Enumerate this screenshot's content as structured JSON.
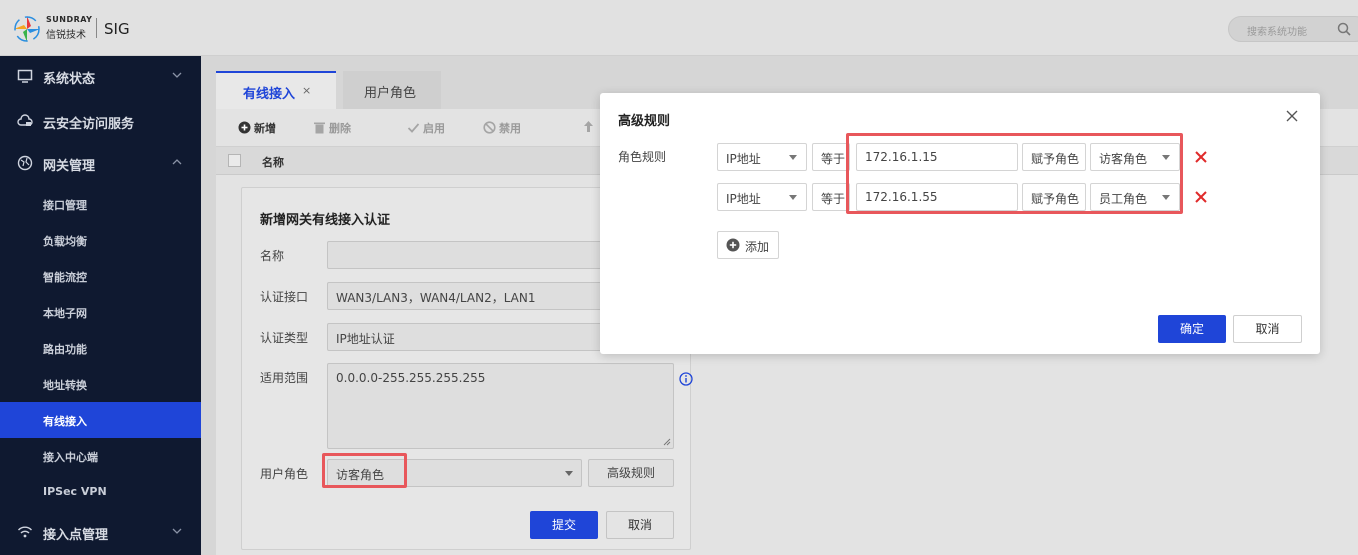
{
  "header": {
    "brand_en": "SUNDRAY",
    "brand_cn": "信锐技术",
    "product": "SIG",
    "search_placeholder": "搜索系统功能"
  },
  "sidebar": {
    "groups": [
      {
        "label": "系统状态"
      },
      {
        "label": "云安全访问服务"
      },
      {
        "label": "网关管理"
      },
      {
        "label": "接入点管理"
      }
    ],
    "items": [
      {
        "label": "接口管理"
      },
      {
        "label": "负载均衡"
      },
      {
        "label": "智能流控"
      },
      {
        "label": "本地子网"
      },
      {
        "label": "路由功能"
      },
      {
        "label": "地址转换"
      },
      {
        "label": "有线接入"
      },
      {
        "label": "接入中心端"
      },
      {
        "label": "IPSec VPN"
      }
    ]
  },
  "tabs": [
    {
      "label": "有线接入",
      "close": "×"
    },
    {
      "label": "用户角色"
    }
  ],
  "toolbar": {
    "add": "新增",
    "delete": "删除",
    "enable": "启用",
    "disable": "禁用"
  },
  "table": {
    "columns": [
      "名称"
    ]
  },
  "form": {
    "title": "新增网关有线接入认证",
    "name_label": "名称",
    "name_value": "",
    "iface_label": "认证接口",
    "iface_value": "WAN3/LAN3，WAN4/LAN2，LAN1",
    "type_label": "认证类型",
    "type_value": "IP地址认证",
    "scope_label": "适用范围",
    "scope_value": "0.0.0.0-255.255.255.255",
    "role_label": "用户角色",
    "role_value": "访客角色",
    "advanced_button": "高级规则",
    "submit": "提交",
    "cancel": "取消"
  },
  "modal": {
    "title": "高级规则",
    "rule_label": "角色规则",
    "rules": [
      {
        "field": "IP地址",
        "op": "等于",
        "value": "172.16.1.15",
        "assign": "赋予角色",
        "role": "访客角色"
      },
      {
        "field": "IP地址",
        "op": "等于",
        "value": "172.16.1.55",
        "assign": "赋予角色",
        "role": "员工角色"
      }
    ],
    "add_button": "添加",
    "ok": "确定",
    "cancel": "取消"
  },
  "colors": {
    "accent": "#1f45d8",
    "sidebar_bg": "#0f1930",
    "highlight": "#e8575b",
    "delete": "#e02b2b"
  }
}
